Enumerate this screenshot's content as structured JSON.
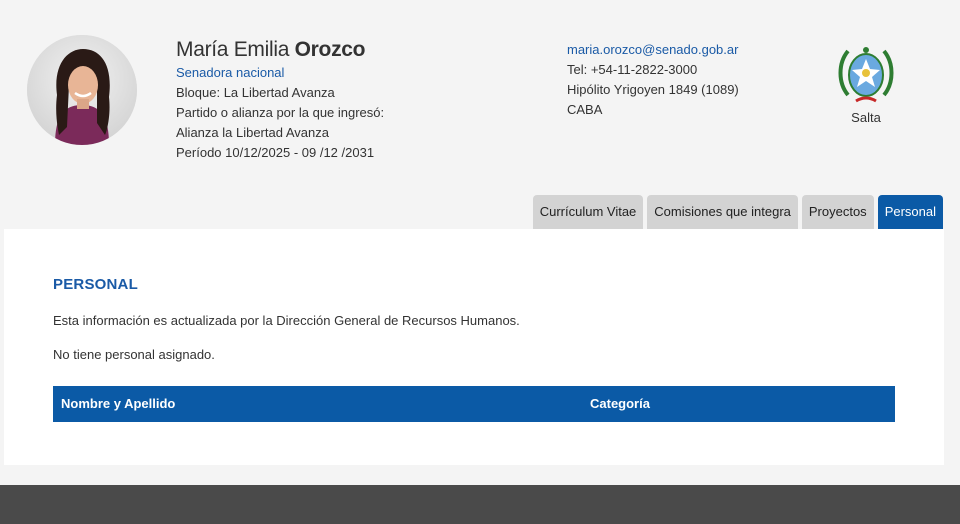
{
  "profile": {
    "first_names": "María Emilia",
    "last_name": "Orozco",
    "role": "Senadora nacional",
    "bloque": "Bloque: La Libertad Avanza",
    "partido_label": "Partido o alianza por la que ingresó:",
    "partido": "Alianza la Libertad Avanza",
    "periodo": "Período 10/12/2025 - 09 /12 /2031"
  },
  "contact": {
    "email": "maria.orozco@senado.gob.ar",
    "tel": "Tel: +54-11-2822-3000",
    "address": "Hipólito Yrigoyen 1849 (1089)",
    "city": "CABA"
  },
  "province": {
    "name": "Salta",
    "crest_icon": "salta-crest-icon"
  },
  "tabs": [
    {
      "label": "Currículum Vitae",
      "active": false
    },
    {
      "label": "Comisiones que integra",
      "active": false
    },
    {
      "label": "Proyectos",
      "active": false
    },
    {
      "label": "Personal",
      "active": true
    }
  ],
  "section": {
    "title": "PERSONAL",
    "info": "Esta información es actualizada por la Dirección General de Recursos Humanos.",
    "empty": "No tiene personal asignado.",
    "columns": [
      "Nombre y Apellido",
      "Categoría"
    ]
  },
  "colors": {
    "accent": "#0b5aa6",
    "link": "#1a5aa6",
    "tab_inactive": "#d3d3d3",
    "footer": "#4a4a4a",
    "page_bg": "#f4f4f4"
  }
}
